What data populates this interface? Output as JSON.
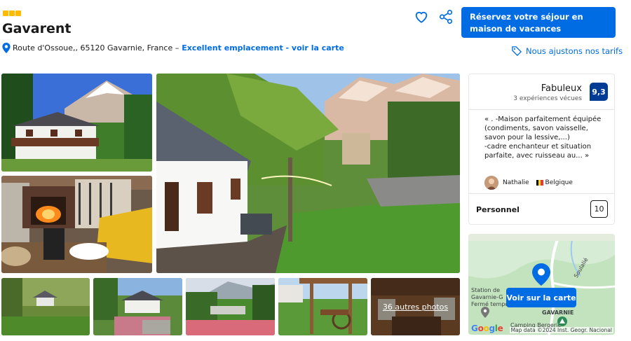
{
  "property": {
    "stars": 3,
    "name": "Gavarent",
    "address": "Route d'Ossoue,, 65120 Gavarnie, France –",
    "location_link": "Excellent emplacement - voir la carte"
  },
  "actions": {
    "favorite_icon": "heart-icon",
    "share_icon": "share-icon",
    "reserve_button": "Réservez votre séjour en maison de vacances",
    "price_match": "Nous ajustons nos tarifs"
  },
  "gallery": {
    "more_photos": "36 autres photos"
  },
  "review": {
    "label": "Fabuleux",
    "count": "3 expériences vécues",
    "score": "9,3",
    "quote": "« . -Maison parfaitement équipée\n(condiments, savon vaisselle,\nsavon pour la lessive,...)\n-cadre enchanteur et situation\nparfaite, avec ruisseau au... »",
    "reviewer": "Nathalie",
    "country": "Belgique",
    "category": "Personnel",
    "category_score": "10"
  },
  "map": {
    "button": "Voir sur la carte",
    "labels": [
      "Station de",
      "Gavarnie-G",
      "Fermé tempo",
      "GAVARNIE",
      "Camping Bergerie",
      "Soulalié"
    ],
    "credit": "Map data ©2024 Inst. Geogr. Nacional",
    "logo": "Google"
  },
  "colors": {
    "primary": "#006ce4",
    "score_bg": "#003b95",
    "star": "#febb02"
  }
}
